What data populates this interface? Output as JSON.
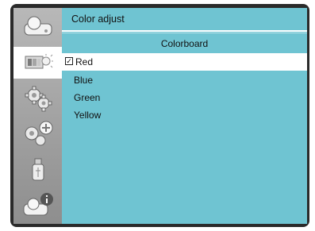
{
  "header": {
    "title": "Color adjust"
  },
  "submenu": {
    "title": "Colorboard"
  },
  "options": [
    {
      "label": "Red",
      "checked": true
    },
    {
      "label": "Blue",
      "checked": false
    },
    {
      "label": "Green",
      "checked": false
    },
    {
      "label": "Yellow",
      "checked": false
    }
  ],
  "sidebar": {
    "items": [
      {
        "icon": "projector-icon"
      },
      {
        "icon": "display-settings-icon",
        "active": true
      },
      {
        "icon": "gear-icon"
      },
      {
        "icon": "advanced-gear-icon"
      },
      {
        "icon": "usb-icon"
      },
      {
        "icon": "projector-info-icon"
      }
    ]
  },
  "colors": {
    "panel": "#6fc4d2",
    "frame": "#2a2a2a",
    "selected_row": "#ffffff"
  },
  "check_mark": "✓"
}
